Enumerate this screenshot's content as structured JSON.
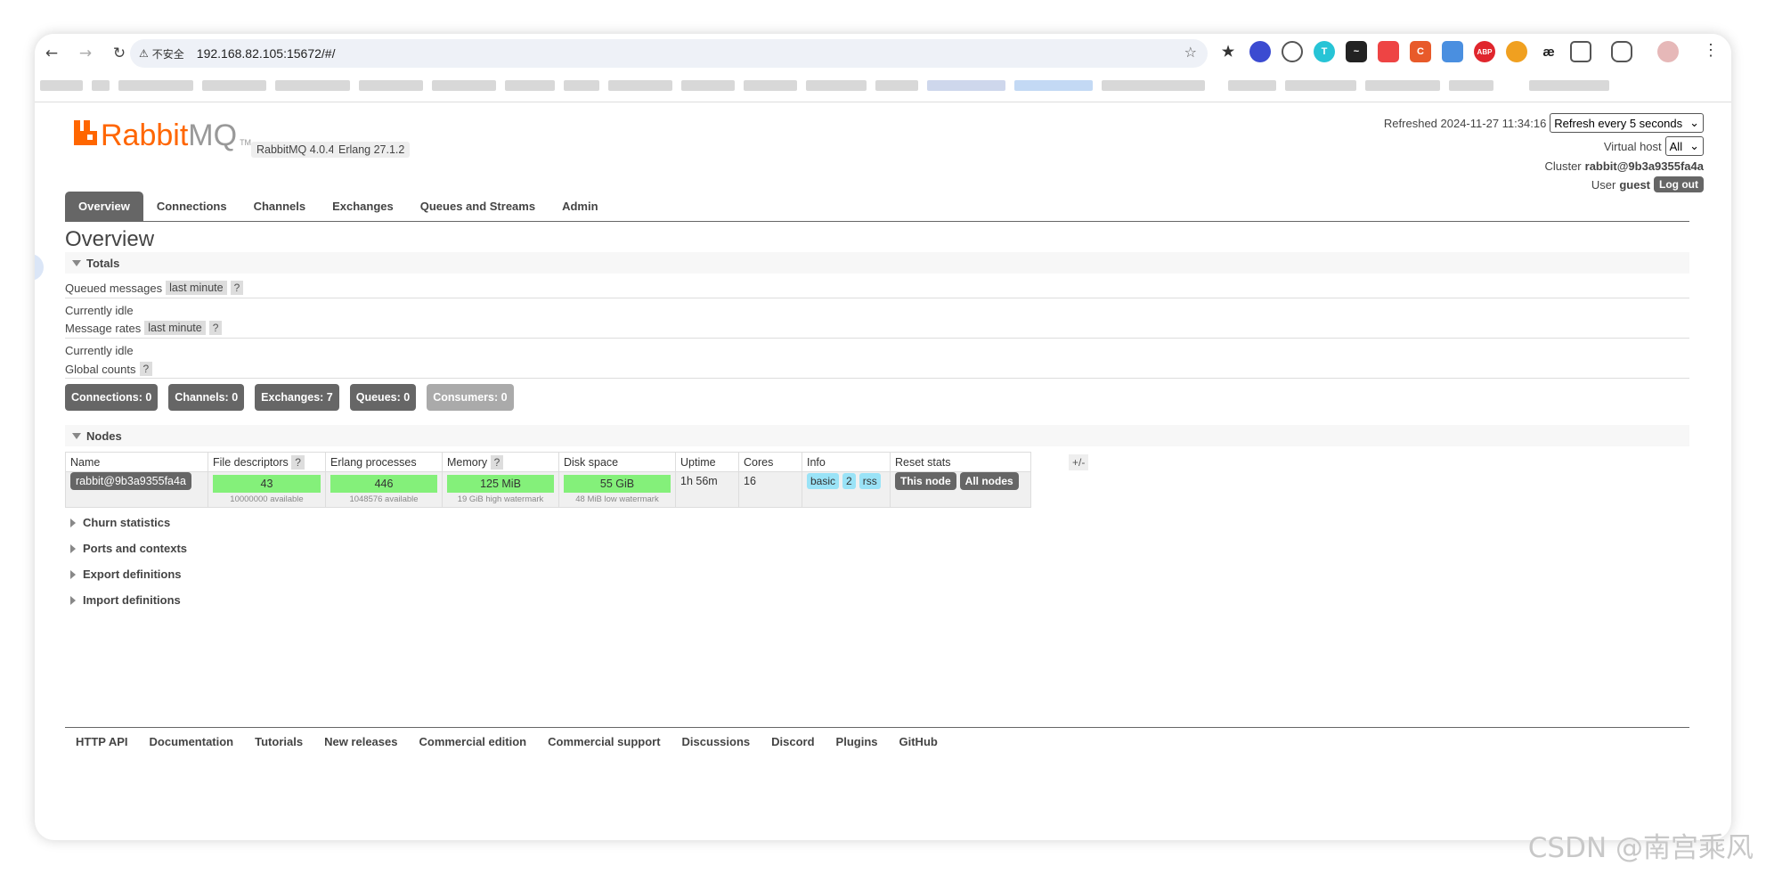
{
  "browser": {
    "nav": {
      "back": "←",
      "forward": "→",
      "reload": "↻"
    },
    "security_label": "不安全",
    "url": "192.168.82.105:15672/#/",
    "star": "☆",
    "menu": "⋮"
  },
  "header": {
    "logo_rabbit": "Rabbit",
    "logo_mq": "MQ",
    "logo_tm": "TM",
    "version": "RabbitMQ 4.0.4",
    "erlang": "Erlang 27.1.2",
    "refreshed_label": "Refreshed 2024-11-27 11:34:16",
    "refresh_select": "Refresh every 5 seconds",
    "vhost_label": "Virtual host",
    "vhost_value": "All",
    "cluster_label": "Cluster",
    "cluster_value": "rabbit@9b3a9355fa4a",
    "user_label": "User",
    "user_value": "guest",
    "logout": "Log out"
  },
  "tabs": [
    "Overview",
    "Connections",
    "Channels",
    "Exchanges",
    "Queues and Streams",
    "Admin"
  ],
  "page_title": "Overview",
  "totals": {
    "heading": "Totals",
    "queued_label": "Queued messages",
    "queued_range": "last minute",
    "help": "?",
    "idle1": "Currently idle",
    "rates_label": "Message rates",
    "rates_range": "last minute",
    "idle2": "Currently idle",
    "global_label": "Global counts"
  },
  "counts": {
    "connections": "Connections: 0",
    "channels": "Channels: 0",
    "exchanges": "Exchanges: 7",
    "queues": "Queues: 0",
    "consumers": "Consumers: 0"
  },
  "nodes": {
    "heading": "Nodes",
    "columns": [
      "Name",
      "File descriptors",
      "Erlang processes",
      "Memory",
      "Disk space",
      "Uptime",
      "Cores",
      "Info",
      "Reset stats"
    ],
    "row": {
      "name": "rabbit@9b3a9355fa4a",
      "fd": "43",
      "fd_sub": "10000000 available",
      "erl": "446",
      "erl_sub": "1048576 available",
      "mem": "125 MiB",
      "mem_sub": "19 GiB high watermark",
      "disk": "55 GiB",
      "disk_sub": "48 MiB low watermark",
      "uptime": "1h 56m",
      "cores": "16",
      "info": [
        "basic",
        "2",
        "rss"
      ],
      "reset_this": "This node",
      "reset_all": "All nodes"
    },
    "plusminus": "+/-"
  },
  "collapsed_sections": [
    "Churn statistics",
    "Ports and contexts",
    "Export definitions",
    "Import definitions"
  ],
  "footer": [
    "HTTP API",
    "Documentation",
    "Tutorials",
    "New releases",
    "Commercial edition",
    "Commercial support",
    "Discussions",
    "Discord",
    "Plugins",
    "GitHub"
  ],
  "watermark": "CSDN @南宫乘风"
}
